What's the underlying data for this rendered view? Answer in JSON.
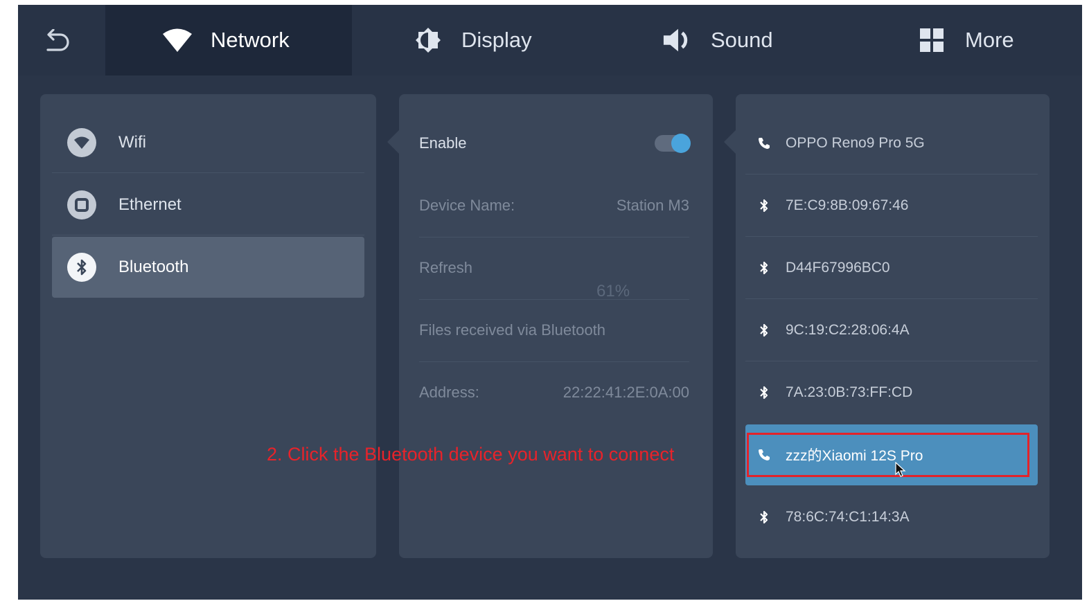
{
  "tabs": {
    "network": "Network",
    "display": "Display",
    "sound": "Sound",
    "more": "More"
  },
  "sidebar": {
    "items": [
      {
        "label": "Wifi",
        "icon": "wifi-icon"
      },
      {
        "label": "Ethernet",
        "icon": "ethernet-icon"
      },
      {
        "label": "Bluetooth",
        "icon": "bluetooth-icon"
      }
    ]
  },
  "settings": {
    "enable_label": "Enable",
    "enable_on": true,
    "device_name_label": "Device Name:",
    "device_name_value": "Station M3",
    "refresh_label": "Refresh",
    "refresh_progress": "61%",
    "files_label": "Files received via Bluetooth",
    "address_label": "Address:",
    "address_value": "22:22:41:2E:0A:00"
  },
  "devices": [
    {
      "name": "OPPO Reno9 Pro 5G",
      "icon": "phone-icon"
    },
    {
      "name": "7E:C9:8B:09:67:46",
      "icon": "bluetooth-icon"
    },
    {
      "name": "D44F67996BC0",
      "icon": "bluetooth-icon"
    },
    {
      "name": "9C:19:C2:28:06:4A",
      "icon": "bluetooth-icon"
    },
    {
      "name": "7A:23:0B:73:FF:CD",
      "icon": "bluetooth-icon"
    },
    {
      "name": "zzz的Xiaomi 12S Pro",
      "icon": "phone-icon"
    },
    {
      "name": "78:6C:74:C1:14:3A",
      "icon": "bluetooth-icon"
    }
  ],
  "annotation": "2. Click the Bluetooth device you want to connect",
  "colors": {
    "accent": "#4c8fbd",
    "annotation": "#e8232a",
    "background": "#2a3548"
  }
}
